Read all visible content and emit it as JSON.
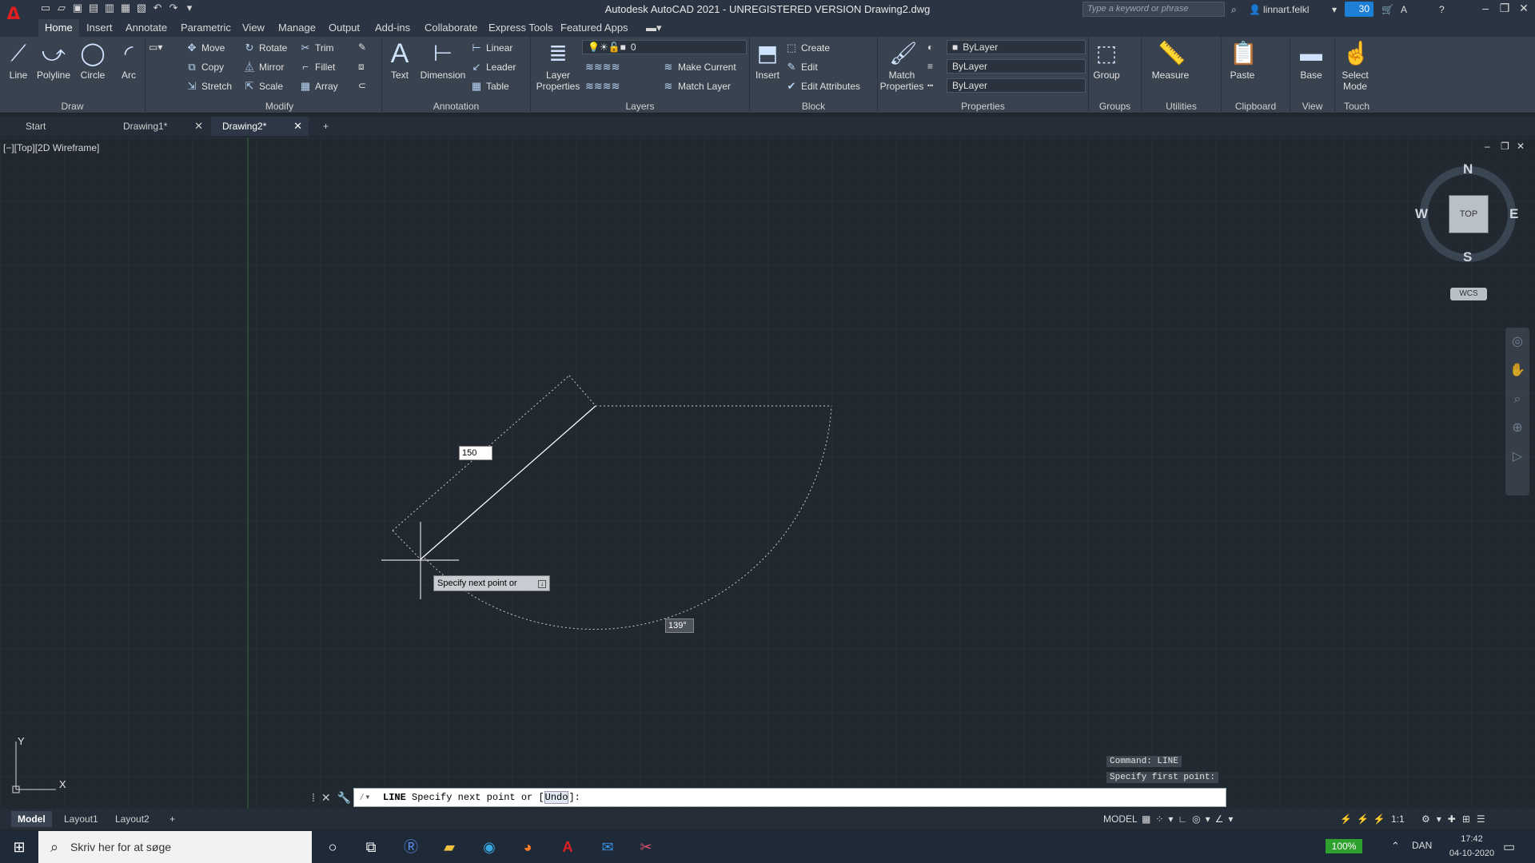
{
  "window": {
    "title": "Autodesk AutoCAD 2021 - UNREGISTERED VERSION    Drawing2.dwg",
    "search_placeholder": "Type a keyword or phrase",
    "user": "linnart.felkl",
    "notification_count": "30"
  },
  "menu": {
    "tabs": [
      "Home",
      "Insert",
      "Annotate",
      "Parametric",
      "View",
      "Manage",
      "Output",
      "Add-ins",
      "Collaborate",
      "Express Tools",
      "Featured Apps"
    ]
  },
  "ribbon": {
    "draw": {
      "title": "Draw",
      "line": "Line",
      "polyline": "Polyline",
      "circle": "Circle",
      "arc": "Arc"
    },
    "modify": {
      "title": "Modify",
      "move": "Move",
      "rotate": "Rotate",
      "trim": "Trim",
      "copy": "Copy",
      "mirror": "Mirror",
      "fillet": "Fillet",
      "stretch": "Stretch",
      "scale": "Scale",
      "array": "Array"
    },
    "annotation": {
      "title": "Annotation",
      "text": "Text",
      "dimension": "Dimension",
      "linear": "Linear",
      "leader": "Leader",
      "table": "Table"
    },
    "layers": {
      "title": "Layers",
      "layer_properties": "Layer Properties",
      "current_layer": "0",
      "make_current": "Make Current",
      "match_layer": "Match Layer"
    },
    "block": {
      "title": "Block",
      "insert": "Insert",
      "create": "Create",
      "edit": "Edit",
      "edit_attributes": "Edit Attributes"
    },
    "properties": {
      "title": "Properties",
      "match_properties": "Match Properties",
      "color": "ByLayer",
      "linetype": "ByLayer",
      "lineweight": "ByLayer"
    },
    "groups": {
      "title": "Groups",
      "group": "Group"
    },
    "utilities": {
      "title": "Utilities",
      "measure": "Measure"
    },
    "clipboard": {
      "title": "Clipboard",
      "paste": "Paste"
    },
    "view": {
      "title": "View",
      "base": "Base"
    },
    "touch": {
      "title": "Touch",
      "select_mode": "Select Mode"
    }
  },
  "doc_tabs": [
    "Start",
    "Drawing1*",
    "Drawing2*"
  ],
  "viewport": {
    "label": "[−][Top][2D Wireframe]",
    "length_input": "150",
    "angle_label": "139°",
    "tooltip": "Specify next point or",
    "compass": {
      "n": "N",
      "s": "S",
      "e": "E",
      "w": "W",
      "top": "TOP",
      "wcs": "WCS"
    },
    "ucs": {
      "x": "X",
      "y": "Y"
    }
  },
  "command": {
    "history1": "Command: LINE",
    "history2": "Specify first point:",
    "prefix": "LINE",
    "prompt": "Specify next point or [",
    "option": "Undo",
    "suffix": "]:"
  },
  "layout_tabs": [
    "Model",
    "Layout1",
    "Layout2"
  ],
  "status": {
    "model": "MODEL",
    "scale": "1:1"
  },
  "taskbar": {
    "search_placeholder": "Skriv her for at søge",
    "battery": "100%",
    "lang": "DAN",
    "time": "17:42",
    "date": "04-10-2020"
  }
}
